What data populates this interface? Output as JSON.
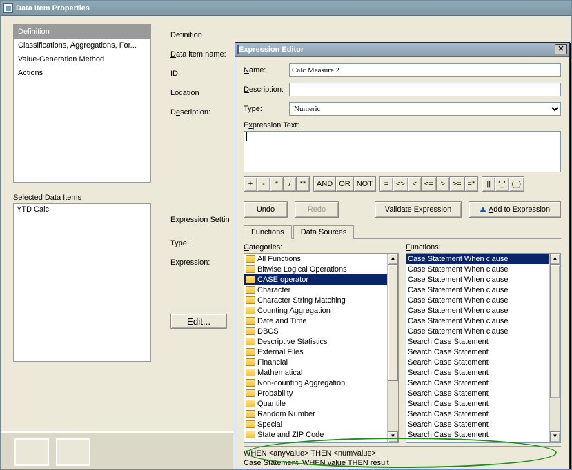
{
  "window": {
    "title": "Data Item Properties"
  },
  "nav": {
    "items": [
      {
        "label": "Definition",
        "selected": true
      },
      {
        "label": "Classifications, Aggregations, For..."
      },
      {
        "label": "Value-Generation Method"
      },
      {
        "label": "Actions"
      }
    ]
  },
  "selected_data_items": {
    "label": "Selected Data Items",
    "value": "YTD Calc"
  },
  "form": {
    "definition": "Definition",
    "data_item_name": "Data item name:",
    "id": "ID:",
    "location": "Location",
    "description": "Description:",
    "expression_settings": "Expression Settin",
    "type": "Type:",
    "expression": "Expression:",
    "edit": "Edit..."
  },
  "modal": {
    "title": "Expression Editor",
    "name_label": "Name:",
    "name_value": "Calc Measure 2",
    "description_label": "Description:",
    "description_value": "",
    "type_label": "Type:",
    "type_value": "Numeric",
    "expr_text_label": "Expression Text:",
    "expr_text_value": "",
    "ops": [
      "+",
      "-",
      "*",
      "/",
      "**"
    ],
    "logic": [
      "AND",
      "OR",
      "NOT"
    ],
    "comp": [
      "=",
      "<>",
      "<",
      "<=",
      ">",
      ">=",
      "=*"
    ],
    "special": [
      "||",
      "'_'",
      "(_)"
    ],
    "undo": "Undo",
    "redo": "Redo",
    "validate": "Validate Expression",
    "add": "Add to Expression",
    "tabs": {
      "functions": "Functions",
      "data_sources": "Data Sources"
    },
    "categories_label": "Categories:",
    "functions_label": "Functions:",
    "categories": [
      "All Functions",
      "Bitwise Logical Operations",
      "CASE operator",
      "Character",
      "Character String Matching",
      "Counting Aggregation",
      "Date and Time",
      "DBCS",
      "Descriptive Statistics",
      "External Files",
      "Financial",
      "Mathematical",
      "Non-counting Aggregation",
      "Probability",
      "Quantile",
      "Random Number",
      "Special",
      "State and ZIP Code"
    ],
    "categories_selected": 2,
    "functions": [
      "Case Statement When clause",
      "Case Statement When clause",
      "Case Statement When clause",
      "Case Statement When clause",
      "Case Statement When clause",
      "Case Statement When clause",
      "Case Statement When clause",
      "Case Statement When clause",
      "Search Case Statement",
      "Search Case Statement",
      "Search Case Statement",
      "Search Case Statement",
      "Search Case Statement",
      "Search Case Statement",
      "Search Case Statement",
      "Search Case Statement",
      "Search Case Statement",
      "Search Case Statement"
    ],
    "functions_selected": 0,
    "hint_syntax": "WHEN <anyValue> THEN <numValue>",
    "hint_desc": "Case Statement: WHEN value THEN result"
  }
}
